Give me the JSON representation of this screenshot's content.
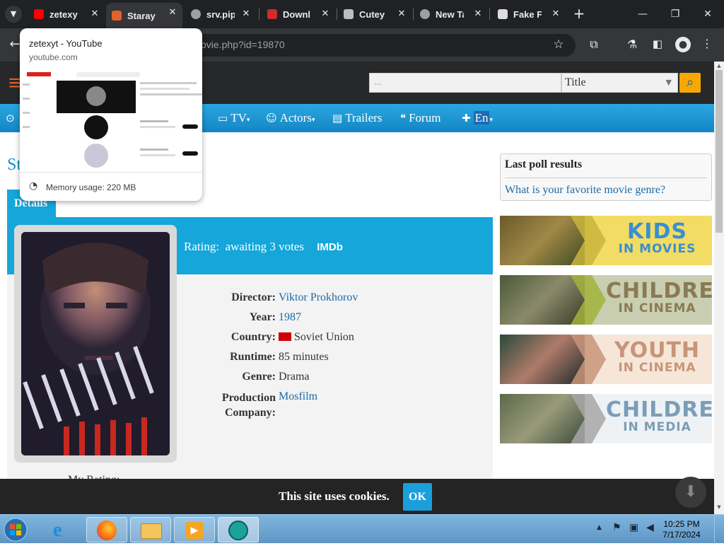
{
  "browser": {
    "tabs": [
      {
        "title": "zetexyt - YouTube",
        "short": "zetexyt",
        "active": false,
        "icon": "youtube-icon"
      },
      {
        "title": "Staraya",
        "short": "Staraye",
        "active": true,
        "icon": "site-favicon"
      },
      {
        "title": "srv.pip",
        "short": "srv.pip",
        "active": false,
        "icon": "globe-icon"
      },
      {
        "title": "Downl",
        "short": "Downl",
        "active": false,
        "icon": "download-site-icon"
      },
      {
        "title": "Cutey",
        "short": "Cutey",
        "active": false,
        "icon": "cutey-icon"
      },
      {
        "title": "New Tab",
        "short": "New Ta",
        "active": false,
        "icon": "globe-icon"
      },
      {
        "title": "Fake F",
        "short": "Fake F",
        "active": false,
        "icon": "fake-icon"
      }
    ],
    "close_glyph": "✕",
    "new_tab_glyph": "+",
    "url_visible": "ovie.php?id=19870",
    "hover_card": {
      "title": "zetexyt - YouTube",
      "domain": "youtube.com",
      "memory": "Memory usage: 220 MB"
    }
  },
  "site": {
    "search": {
      "placeholder": "...",
      "select_value": "Title"
    },
    "nav": [
      {
        "label": "TV",
        "icon": "tv-icon",
        "dropdown": true
      },
      {
        "label": "Actors",
        "icon": "actors-icon",
        "dropdown": true
      },
      {
        "label": "Trailers",
        "icon": "film-icon",
        "dropdown": false
      },
      {
        "label": "Forum",
        "icon": "chat-icon",
        "dropdown": false
      },
      {
        "label": "En",
        "icon": "uk-flag-icon",
        "dropdown": true
      }
    ],
    "title_partial": "St",
    "details_tab": "Details",
    "rating": {
      "label": "Rating:",
      "value": "awaiting 3 votes",
      "imdb": "IMDb"
    },
    "info": [
      {
        "label": "Director:",
        "value": "Viktor Prokhorov",
        "link": true
      },
      {
        "label": "Year:",
        "value": "1987",
        "link": true
      },
      {
        "label": "Country:",
        "value": "Soviet Union",
        "link": false,
        "flag": true
      },
      {
        "label": "Runtime:",
        "value": "85 minutes",
        "link": false
      },
      {
        "label": "Genre:",
        "value": "Drama",
        "link": false
      },
      {
        "label": "Production Company:",
        "value": "Mosfilm",
        "link": true
      }
    ],
    "my_rating": "My Rating:",
    "poll": {
      "title": "Last poll results",
      "link": "What is your favorite movie genre?"
    },
    "banners": [
      {
        "line1": "KIDS",
        "line2": "IN MOVIES",
        "bg": "#f2dc64",
        "color": "#3a8fd0",
        "chev": "#c9b53c"
      },
      {
        "line1": "CHILDREN",
        "line2": "IN CINEMA",
        "bg": "#c9ceb0",
        "color": "#8a7a54",
        "chev": "#a3b33d"
      },
      {
        "line1": "YOUTH",
        "line2": "IN CINEMA",
        "bg": "#f6e6d8",
        "color": "#c8957a",
        "chev": "#c8957a"
      },
      {
        "line1": "CHILDREN",
        "line2": "IN MEDIA",
        "bg": "#eef2f4",
        "color": "#7b9db8",
        "chev": "#a7a7a7"
      }
    ],
    "cookie": {
      "text": "This site uses cookies.",
      "ok": "OK"
    }
  },
  "taskbar": {
    "time": "10:25 PM",
    "date": "7/17/2024"
  }
}
